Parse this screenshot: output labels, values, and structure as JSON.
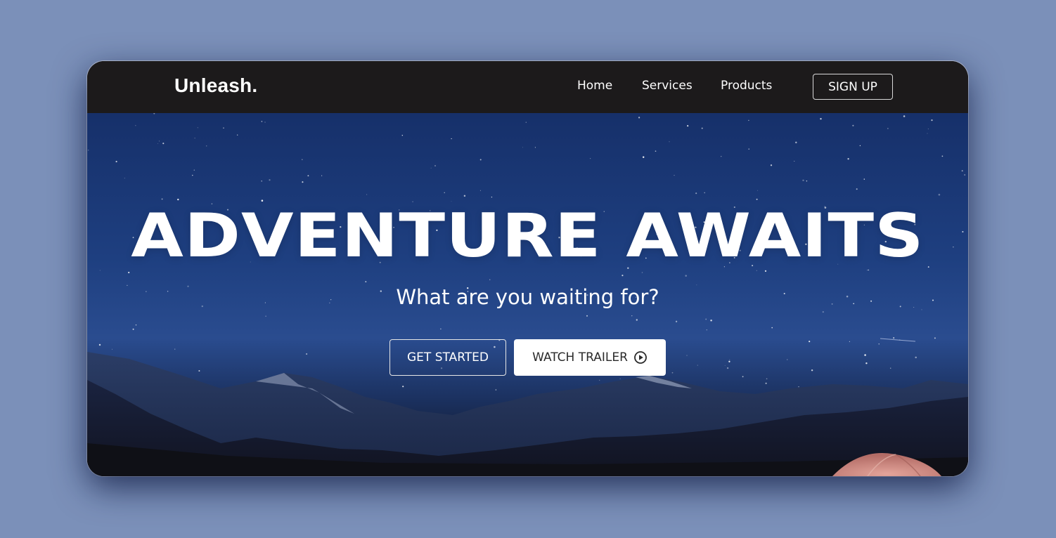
{
  "navbar": {
    "logo": "Unleash.",
    "links": [
      "Home",
      "Services",
      "Products"
    ],
    "signup_label": "SIGN UP"
  },
  "hero": {
    "headline": "ADVENTURE AWAITS",
    "subheadline": "What are you waiting for?",
    "primary_button": "GET STARTED",
    "secondary_button": "WATCH TRAILER",
    "secondary_icon": "play-circle-icon"
  },
  "colors": {
    "page_background": "#7b90b9",
    "navbar_background": "#1c1a1b",
    "sky_top": "#16306a",
    "sky_mid": "#2a4c8f",
    "text": "#ffffff",
    "trailer_button_bg": "#ffffff",
    "tent": "#c97f77"
  }
}
